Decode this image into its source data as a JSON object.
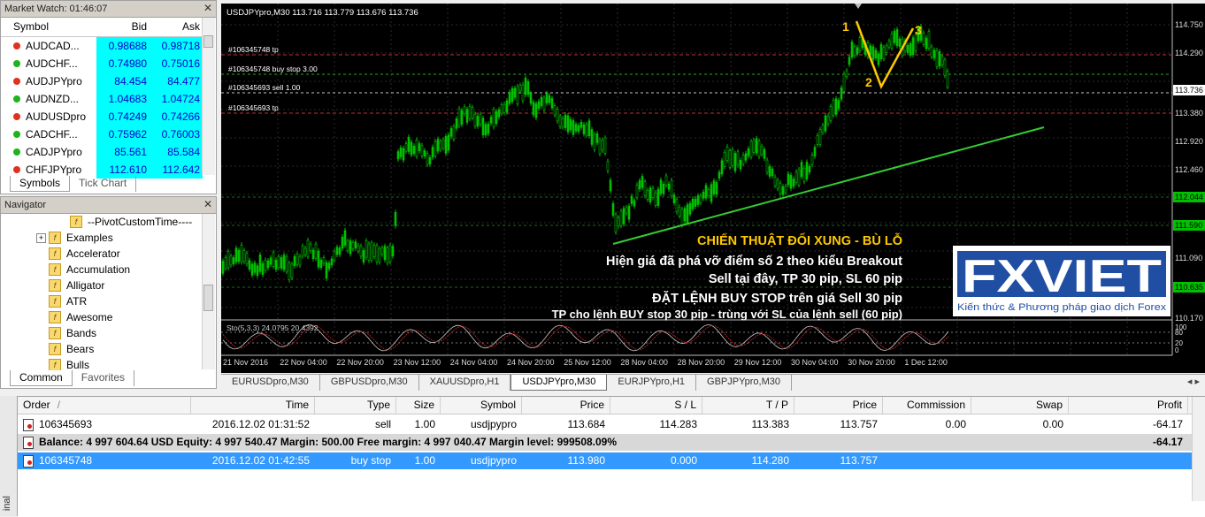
{
  "market_watch": {
    "title": "Market Watch: 01:46:07",
    "columns": {
      "symbol": "Symbol",
      "bid": "Bid",
      "ask": "Ask"
    },
    "rows": [
      {
        "symbol": "AUDCAD...",
        "bid": "0.98688",
        "ask": "0.98718",
        "dir": "dn"
      },
      {
        "symbol": "AUDCHF...",
        "bid": "0.74980",
        "ask": "0.75016",
        "dir": "up"
      },
      {
        "symbol": "AUDJPYpro",
        "bid": "84.454",
        "ask": "84.477",
        "dir": "dn"
      },
      {
        "symbol": "AUDNZD...",
        "bid": "1.04683",
        "ask": "1.04724",
        "dir": "up"
      },
      {
        "symbol": "AUDUSDpro",
        "bid": "0.74249",
        "ask": "0.74266",
        "dir": "dn"
      },
      {
        "symbol": "CADCHF...",
        "bid": "0.75962",
        "ask": "0.76003",
        "dir": "up"
      },
      {
        "symbol": "CADJPYpro",
        "bid": "85.561",
        "ask": "85.584",
        "dir": "up"
      },
      {
        "symbol": "CHFJPYpro",
        "bid": "112.610",
        "ask": "112.642",
        "dir": "dn"
      }
    ],
    "tabs": [
      "Symbols",
      "Tick Chart"
    ]
  },
  "navigator": {
    "title": "Navigator",
    "items": [
      {
        "label": "--PivotCustomTime----",
        "expander": ""
      },
      {
        "label": "Examples",
        "expander": "+"
      },
      {
        "label": "Accelerator",
        "expander": ""
      },
      {
        "label": "Accumulation",
        "expander": ""
      },
      {
        "label": "Alligator",
        "expander": ""
      },
      {
        "label": "ATR",
        "expander": ""
      },
      {
        "label": "Awesome",
        "expander": ""
      },
      {
        "label": "Bands",
        "expander": ""
      },
      {
        "label": "Bears",
        "expander": ""
      },
      {
        "label": "Bulls",
        "expander": ""
      }
    ],
    "tabs": [
      "Common",
      "Favorites"
    ]
  },
  "chart": {
    "header": "USDJPYpro,M30  113.716 113.779 113.676 113.736",
    "order_labels": [
      "#106345748 tp",
      "#106345748 buy stop 3.00",
      "#106345693 sell 1.00",
      "#106345693 tp"
    ],
    "price_labels": [
      "114.750",
      "114.290",
      "113.736",
      "113.380",
      "112.920",
      "112.460",
      "112.044",
      "111.590",
      "111.090",
      "110.635",
      "110.170"
    ],
    "current_price": "113.736",
    "time_labels": [
      "21 Nov 2016",
      "22 Nov 04:00",
      "22 Nov 20:00",
      "23 Nov 12:00",
      "24 Nov 04:00",
      "24 Nov 20:00",
      "25 Nov 12:00",
      "28 Nov 04:00",
      "28 Nov 20:00",
      "29 Nov 12:00",
      "30 Nov 04:00",
      "30 Nov 20:00",
      "1 Dec 12:00"
    ],
    "stoch_label": "Sto(5,3,3) 24.0795 20.4392",
    "stoch_scale": [
      "100",
      "80",
      "20",
      "0"
    ],
    "pattern_labels": [
      "1",
      "2",
      "3"
    ],
    "annotation": {
      "title": "CHIẾN THUẬT ĐỐI XUNG - BÙ LỖ",
      "line1": "Hiện giá đã phá vỡ điểm số 2 theo kiểu Breakout",
      "line2": "Sell tại đây, TP 30 pip, SL 60 pip",
      "line3": "ĐẶT LỆNH BUY STOP trên giá Sell 30 pip",
      "line4": "TP cho lệnh BUY stop 30 pip - trùng với SL của lệnh sell (60 pip)"
    },
    "logo": {
      "brand": "FXVIET",
      "tagline": "Kiến thức & Phương pháp giao dịch Forex"
    },
    "colors": {
      "candle": "#00c000",
      "trendline": "#33cc33",
      "pattern": "#ffc800",
      "order_line": "#b02020",
      "annotation_title": "#ffc800"
    }
  },
  "chart_tabs": [
    {
      "label": "EURUSDpro,M30",
      "active": false
    },
    {
      "label": "GBPUSDpro,M30",
      "active": false
    },
    {
      "label": "XAUUSDpro,H1",
      "active": false
    },
    {
      "label": "USDJPYpro,M30",
      "active": true
    },
    {
      "label": "EURJPYpro,H1",
      "active": false
    },
    {
      "label": "GBPJPYpro,M30",
      "active": false
    }
  ],
  "terminal": {
    "side_label": "inal",
    "columns": [
      "Order",
      "Time",
      "Type",
      "Size",
      "Symbol",
      "Price",
      "S / L",
      "T / P",
      "Price",
      "Commission",
      "Swap",
      "Profit"
    ],
    "order_sort_mark": "/",
    "orders": [
      {
        "order": "106345693",
        "time": "2016.12.02 01:31:52",
        "type": "sell",
        "size": "1.00",
        "symbol": "usdjpypro",
        "price": "113.684",
        "sl": "114.283",
        "tp": "113.383",
        "cur": "113.757",
        "commission": "0.00",
        "swap": "0.00",
        "profit": "-64.17"
      },
      {
        "order": "106345748",
        "time": "2016.12.02 01:42:55",
        "type": "buy stop",
        "size": "1.00",
        "symbol": "usdjpypro",
        "price": "113.980",
        "sl": "0.000",
        "tp": "114.280",
        "cur": "113.757",
        "commission": "",
        "swap": "",
        "profit": ""
      }
    ],
    "balance_line": "Balance: 4 997 604.64 USD  Equity: 4 997 540.47  Margin: 500.00  Free margin: 4 997 040.47  Margin level: 999508.09%",
    "balance_profit": "-64.17"
  }
}
